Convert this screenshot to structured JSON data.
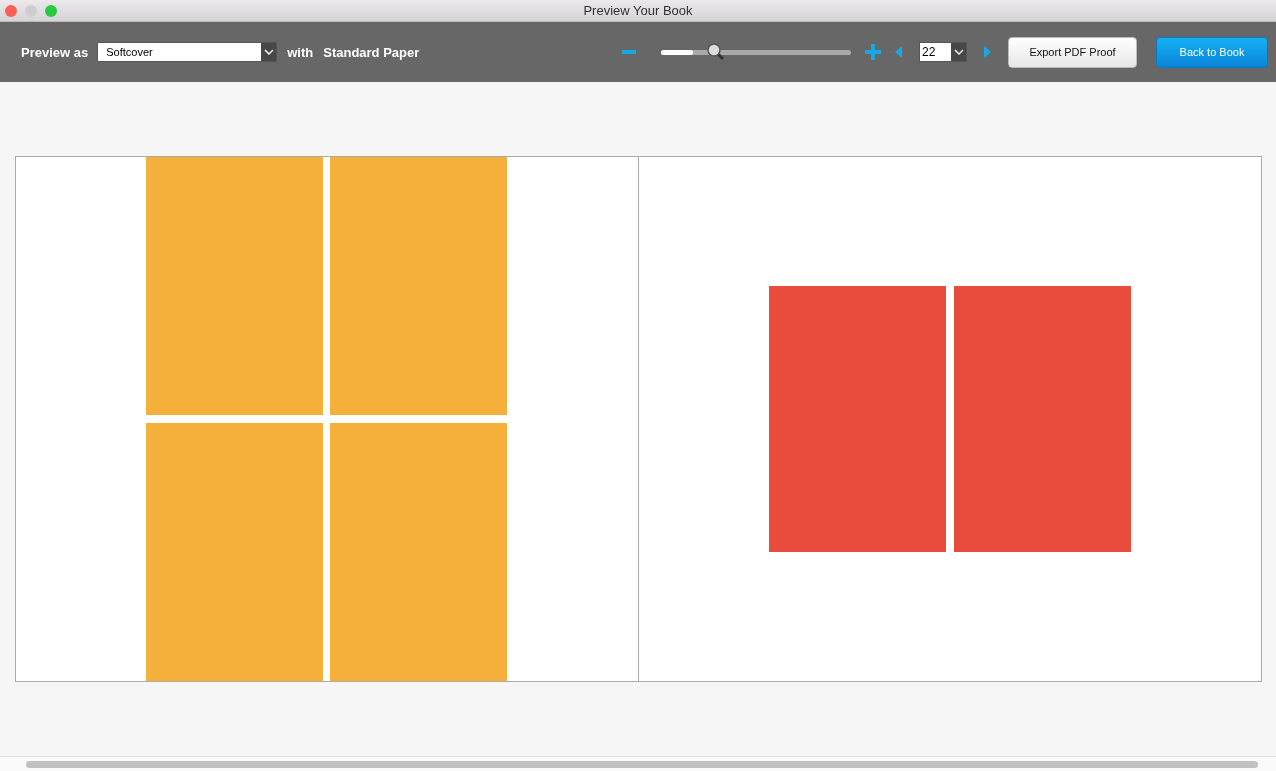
{
  "window": {
    "title": "Preview Your Book"
  },
  "toolbar": {
    "preview_label": "Preview as",
    "format": {
      "value": "Softcover"
    },
    "with_label": "with",
    "paper": "Standard Paper",
    "zoom": {
      "level": 0.17
    },
    "page": {
      "value": "22"
    },
    "export_button": "Export PDF Proof",
    "back_button": "Back to Book"
  },
  "pages": [
    {
      "kind": "grid",
      "color": "#f5af3b"
    },
    {
      "kind": "pair",
      "color": "#e94b3c"
    }
  ]
}
